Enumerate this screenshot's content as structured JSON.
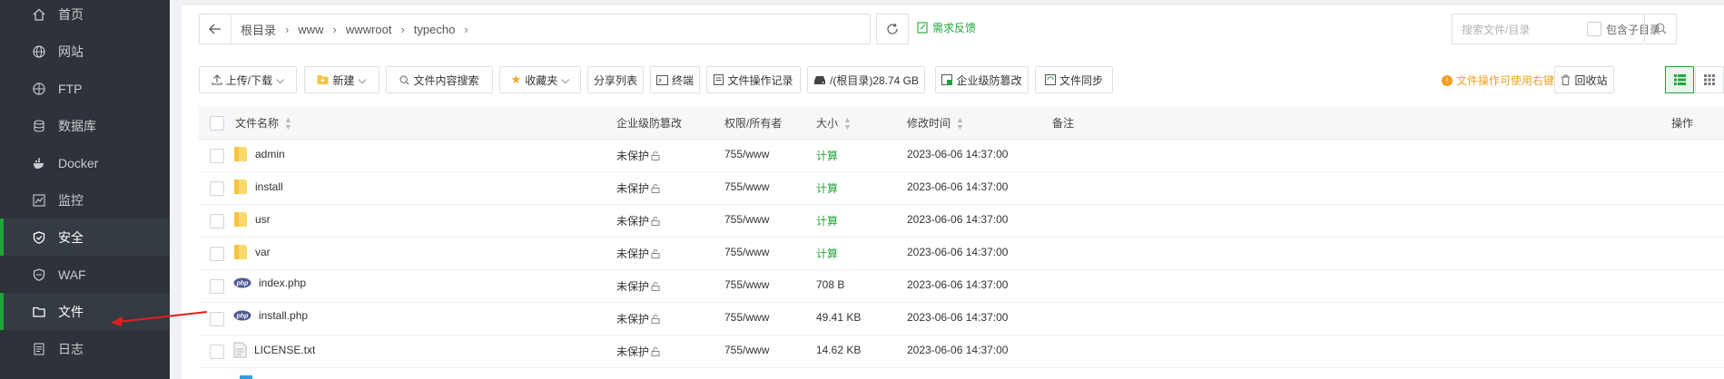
{
  "sidebar": {
    "items": [
      {
        "label": "首页",
        "icon": "home-icon"
      },
      {
        "label": "网站",
        "icon": "globe-icon"
      },
      {
        "label": "FTP",
        "icon": "ftp-icon"
      },
      {
        "label": "数据库",
        "icon": "database-icon"
      },
      {
        "label": "Docker",
        "icon": "docker-icon"
      },
      {
        "label": "监控",
        "icon": "monitor-icon"
      },
      {
        "label": "安全",
        "icon": "shield-icon"
      },
      {
        "label": "WAF",
        "icon": "waf-shield-icon"
      },
      {
        "label": "文件",
        "icon": "folder-icon"
      },
      {
        "label": "日志",
        "icon": "log-icon"
      }
    ]
  },
  "pathbar": {
    "crumbs": [
      "根目录",
      "www",
      "wwwroot",
      "typecho"
    ],
    "feedback": "需求反馈"
  },
  "search": {
    "placeholder": "搜索文件/目录",
    "subdir_label": "包含子目录"
  },
  "toolbar": {
    "upload": "上传/下载",
    "new": "新建",
    "content_search": "文件内容搜索",
    "favorites": "收藏夹",
    "share_list": "分享列表",
    "terminal": "终端",
    "op_log": "文件操作记录",
    "disk": "/(根目录)28.74 GB",
    "tamper": "企业级防篡改",
    "sync": "文件同步",
    "tip": "文件操作可使用右键",
    "recycle": "回收站"
  },
  "table": {
    "headers": {
      "name": "文件名称",
      "tamper": "企业级防篡改",
      "perm": "权限/所有者",
      "size": "大小",
      "mtime": "修改时间",
      "note": "备注",
      "ops": "操作"
    },
    "rows": [
      {
        "name": "admin",
        "type": "folder",
        "tamper": "未保护",
        "perm": "755/www",
        "size": "计算",
        "mtime": "2023-06-06 14:37:00"
      },
      {
        "name": "install",
        "type": "folder",
        "tamper": "未保护",
        "perm": "755/www",
        "size": "计算",
        "mtime": "2023-06-06 14:37:00"
      },
      {
        "name": "usr",
        "type": "folder",
        "tamper": "未保护",
        "perm": "755/www",
        "size": "计算",
        "mtime": "2023-06-06 14:37:00"
      },
      {
        "name": "var",
        "type": "folder",
        "tamper": "未保护",
        "perm": "755/www",
        "size": "计算",
        "mtime": "2023-06-06 14:37:00"
      },
      {
        "name": "index.php",
        "type": "php",
        "tamper": "未保护",
        "perm": "755/www",
        "size": "708 B",
        "mtime": "2023-06-06 14:37:00"
      },
      {
        "name": "install.php",
        "type": "php",
        "tamper": "未保护",
        "perm": "755/www",
        "size": "49.41 KB",
        "mtime": "2023-06-06 14:37:00"
      },
      {
        "name": "LICENSE.txt",
        "type": "txt",
        "tamper": "未保护",
        "perm": "755/www",
        "size": "14.62 KB",
        "mtime": "2023-06-06 14:37:00"
      }
    ]
  },
  "colors": {
    "accent": "#20a53a",
    "sidebar_bg": "#2e3339",
    "tip": "#f0a020",
    "annotation_arrow": "#e02020"
  }
}
